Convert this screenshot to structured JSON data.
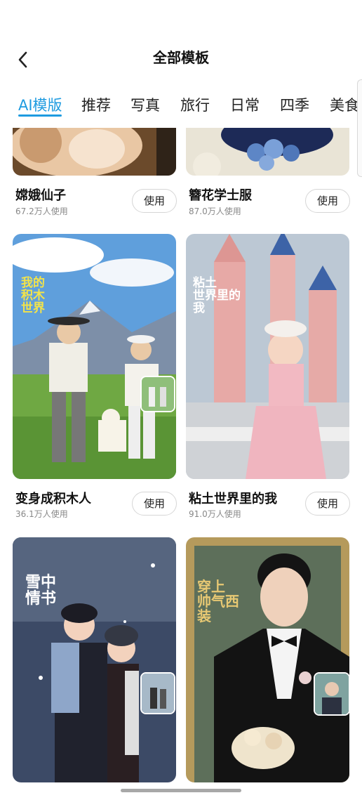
{
  "header": {
    "title": "全部模板"
  },
  "tabs": [
    "AI模版",
    "推荐",
    "写真",
    "旅行",
    "日常",
    "四季",
    "美食"
  ],
  "cards": [
    {
      "name": "嫦娥仙子",
      "count": "67.2万人使用",
      "button": "使用"
    },
    {
      "name": "簪花学士服",
      "count": "87.0万人使用",
      "button": "使用"
    },
    {
      "name": "变身成积木人",
      "count": "36.1万人使用",
      "button": "使用",
      "art_text": [
        "我的",
        "积木",
        "世界"
      ]
    },
    {
      "name": "粘土世界里的我",
      "count": "91.0万人使用",
      "button": "使用",
      "art_text": [
        "粘土",
        "世界里的",
        "我"
      ]
    },
    {
      "art_text": [
        "雪中",
        "情书"
      ]
    },
    {
      "art_text": [
        "穿上",
        "帅气西装"
      ]
    }
  ],
  "colors": {
    "accent": "#1e9be0",
    "text": "#111111",
    "muted": "#888888",
    "button_border": "#d6d6d6"
  }
}
